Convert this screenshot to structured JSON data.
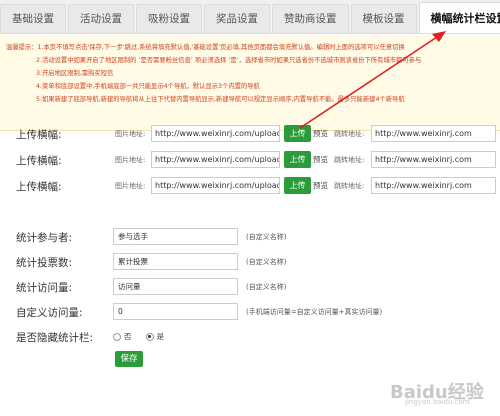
{
  "tabs": [
    {
      "label": "基础设置",
      "active": false
    },
    {
      "label": "活动设置",
      "active": false
    },
    {
      "label": "吸粉设置",
      "active": false
    },
    {
      "label": "奖品设置",
      "active": false
    },
    {
      "label": "赞助商设置",
      "active": false
    },
    {
      "label": "模板设置",
      "active": false
    },
    {
      "label": "横幅统计栏设置",
      "active": true
    }
  ],
  "notice": {
    "lead": "温馨提示：",
    "lines": [
      "1.本页不填写点击'保存,下一步'跳过,系统将填充默认值,'基础设置'页必填,其他页面都会填充默认值。编辑时上面的选项可以任意切换",
      "2.活动设置中如果开启了地区限制的 ‘是否需要粉丝信息’ 项必须选择 ‘是’，选择省市时如果只选省份不选城市则该省份下所有城市都可参与",
      "3.开启地区限制,需购买短信",
      "4.菜单和底部设置中,手机端底部一共只能显示4个导航，默认显示3个内置的导航",
      "5.如果新建了底部导航,新建的导航将从上往下代替内置导航显示,新建导航可以规定显示顺序,内置导航不能。最多只能新建4个新导航"
    ]
  },
  "uploads": [
    {
      "label": "上传横幅:",
      "img_label": "图片地址:",
      "img_value": "http://www.weixinrj.com/uploads/r",
      "btn": "上传",
      "preview": "预览",
      "link_label": "跳转地址:",
      "link_value": "http://www.weixinrj.com"
    },
    {
      "label": "上传横幅:",
      "img_label": "图片地址:",
      "img_value": "http://www.weixinrj.com/uploads/r",
      "btn": "上传",
      "preview": "预览",
      "link_label": "跳转地址:",
      "link_value": "http://www.weixinrj.com"
    },
    {
      "label": "上传横幅:",
      "img_label": "图片地址:",
      "img_value": "http://www.weixinrj.com/uploads/r",
      "btn": "上传",
      "preview": "预览",
      "link_label": "跳转地址:",
      "link_value": "http://www.weixinrj.com"
    }
  ],
  "form": {
    "participants": {
      "label": "统计参与者:",
      "value": "参与选手",
      "hint": "(自定义名称)"
    },
    "votes": {
      "label": "统计投票数:",
      "value": "累计投票",
      "hint": "(自定义名称)"
    },
    "visits": {
      "label": "统计访问量:",
      "value": "访问量",
      "hint": "(自定义名称)"
    },
    "custom_visits": {
      "label": "自定义访问量:",
      "value": "0",
      "hint": "(手机端访问量=自定义访问量+真实访问量)"
    },
    "hide_bar": {
      "label": "是否隐藏统计栏:",
      "options": [
        "否",
        "是"
      ],
      "selected": "是"
    },
    "save": "保存"
  },
  "watermark": {
    "main": "Baidu经验",
    "sub": "jingyan.baidu.com"
  },
  "colors": {
    "accent_green": "#2b9c3a",
    "notice_text": "#d04020",
    "annotation_red": "#e02020"
  }
}
